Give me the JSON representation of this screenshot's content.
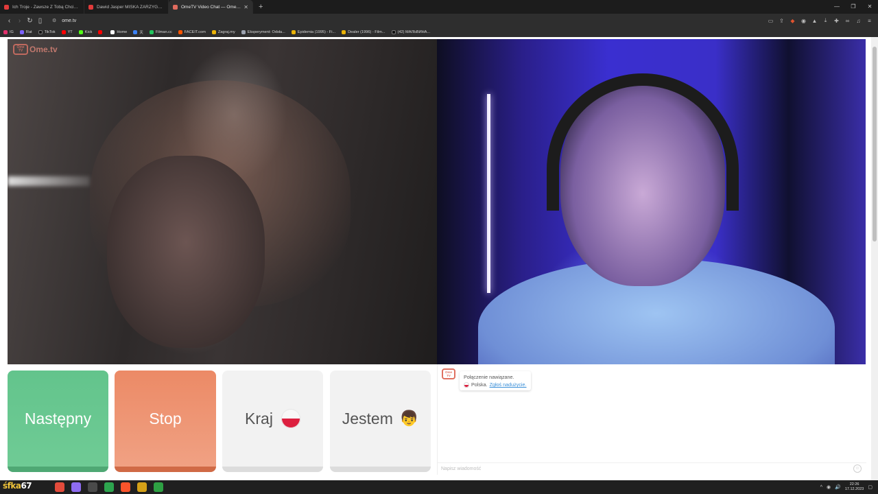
{
  "browser": {
    "tabs": [
      {
        "title": "Ich Troje - Zawsze Z Tobą Chciałbym Być",
        "active": false
      },
      {
        "title": "Dawid Jasper MIŚKA ZARZYGAŁA MI...",
        "active": false
      },
      {
        "title": "OmeTV Video Chat — Omegle",
        "active": true
      }
    ],
    "new_tab": "+",
    "address": "ome.tv",
    "bookmarks": [
      {
        "label": "IG",
        "color": "#e1306c"
      },
      {
        "label": "Rat",
        "color": "#7b61ff"
      },
      {
        "label": "TikTok",
        "color": "#111111"
      },
      {
        "label": "YT",
        "color": "#ff0000"
      },
      {
        "label": "Kick",
        "color": "#53fc18"
      },
      {
        "label": "",
        "color": "#ff0000"
      },
      {
        "label": "Home",
        "color": "#ffffff"
      },
      {
        "label": "天",
        "color": "#3b82f6"
      },
      {
        "label": "Filman.cc",
        "color": "#22c55e"
      },
      {
        "label": "FACEIT.com",
        "color": "#ff5500"
      },
      {
        "label": "Zagraj.my",
        "color": "#eab308"
      },
      {
        "label": "Eksperyment: Odsła...",
        "color": "#9ca3af"
      },
      {
        "label": "Epidemia (1995) - Fi...",
        "color": "#eab308"
      },
      {
        "label": "Dealer (1996) - Film...",
        "color": "#eab308"
      },
      {
        "label": "(42) МАЛЬВИНА...",
        "color": "#111111"
      }
    ]
  },
  "app": {
    "logo_text": "Ome.tv",
    "logo_box_text": "Ome TV",
    "buttons": {
      "next": "Następny",
      "stop": "Stop",
      "country": "Kraj",
      "gender": "Jestem"
    },
    "gender_emoji": "👦",
    "chat": {
      "message_line1": "Połączenie nawiązane.",
      "country": "Polska.",
      "report_link": "Zgłoś nadużycie.",
      "input_placeholder": "Napisz wiadomość"
    }
  },
  "taskbar": {
    "overlay_text": "ka",
    "overlay_prefix": "śf",
    "overlay_number": "67",
    "time": "22:26",
    "date": "17.12.2023",
    "icon_colors": [
      "#e34b3b",
      "#8e6cf0",
      "#4a4a4a",
      "#2da44e",
      "#fb542b",
      "#d4a017",
      "#2ea043"
    ]
  },
  "colors": {
    "next_green": "#63c48c",
    "stop_orange": "#ec8a66",
    "report_blue": "#3a8fd8"
  }
}
